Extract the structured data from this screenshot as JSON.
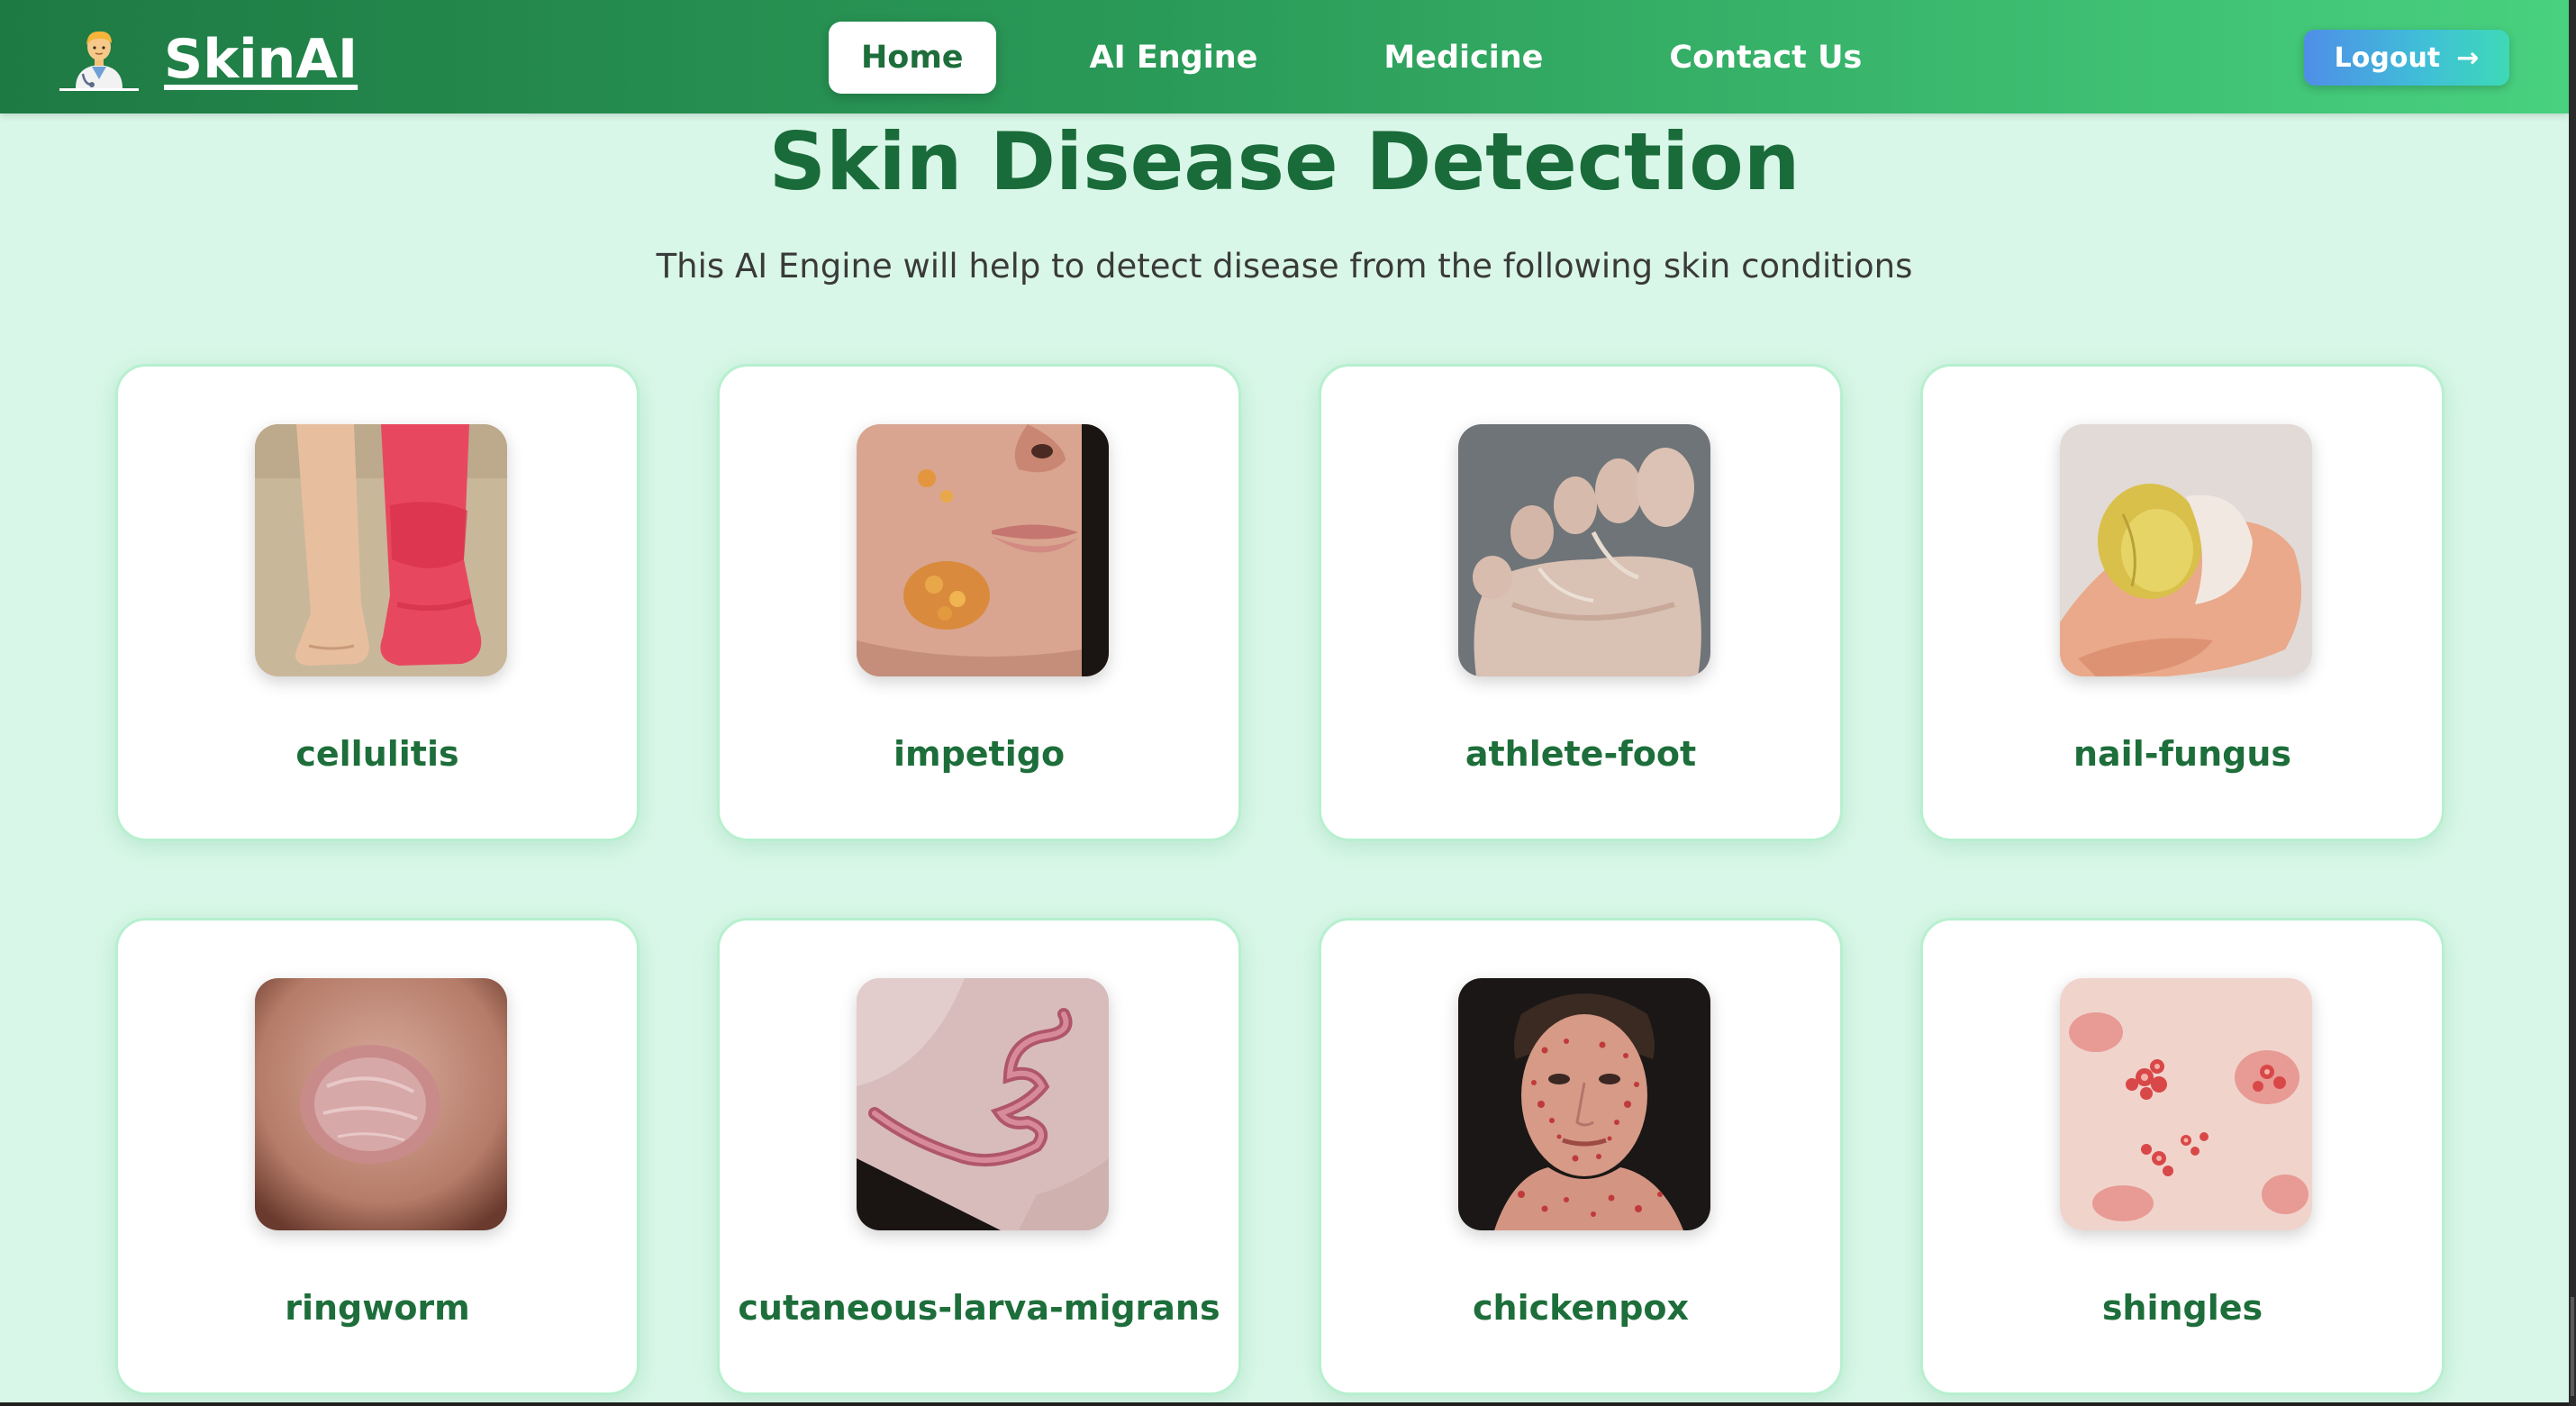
{
  "brand": {
    "name": "SkinAI",
    "logo_icon": "doctor-emoji-icon"
  },
  "nav": {
    "items": [
      {
        "label": "Home",
        "active": true
      },
      {
        "label": "AI Engine",
        "active": false
      },
      {
        "label": "Medicine",
        "active": false
      },
      {
        "label": "Contact Us",
        "active": false
      }
    ]
  },
  "logout": {
    "label": "Logout",
    "icon": "arrow-right-icon",
    "arrow": "→"
  },
  "hero": {
    "title": "Skin Disease Detection",
    "subtitle": "This AI Engine will help to detect disease from the following skin conditions"
  },
  "conditions": [
    {
      "label": "cellulitis",
      "image": "cellulitis-photo"
    },
    {
      "label": "impetigo",
      "image": "impetigo-photo"
    },
    {
      "label": "athlete-foot",
      "image": "athlete-foot-photo"
    },
    {
      "label": "nail-fungus",
      "image": "nail-fungus-photo"
    },
    {
      "label": "ringworm",
      "image": "ringworm-photo"
    },
    {
      "label": "cutaneous-larva-migrans",
      "image": "cutaneous-larva-migrans-photo"
    },
    {
      "label": "chickenpox",
      "image": "chickenpox-photo"
    },
    {
      "label": "shingles",
      "image": "shingles-photo"
    }
  ],
  "colors": {
    "navbar_start": "#1e7a43",
    "navbar_end": "#48d17f",
    "page_bg": "#d9f7e8",
    "accent_text": "#1d6e3a",
    "card_border": "#b7f0cf",
    "logout_start": "#4f8ee8",
    "logout_end": "#3ed9b7"
  }
}
